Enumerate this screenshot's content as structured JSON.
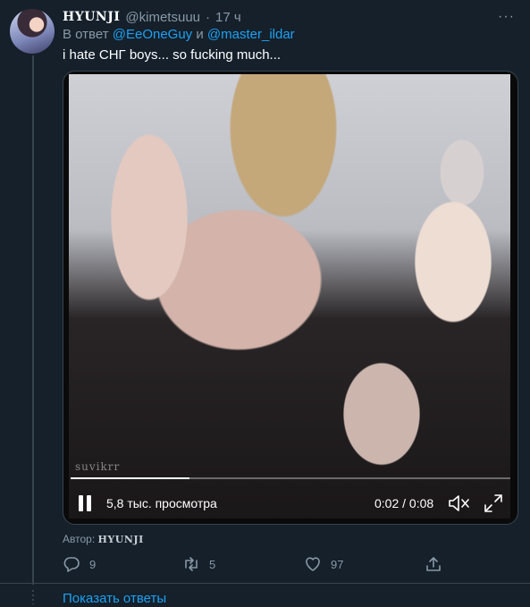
{
  "tweet": {
    "display_name": "HYUNJI",
    "handle": "@kimetsuuu",
    "separator": "·",
    "time": "17 ч",
    "more_glyph": "···",
    "reply_prefix": "В ответ",
    "reply_mention_1": "@EeOneGuy",
    "reply_conjunction": "и",
    "reply_mention_2": "@master_ildar",
    "text": "i hate СНГ boys... so fucking much..."
  },
  "video": {
    "watermark": "suvikrr",
    "progress_fraction": 0.27,
    "views": "5,8 тыс. просмотра",
    "timecode": "0:02 / 0:08"
  },
  "byline": {
    "prefix": "Автор:",
    "author": "HYUNJI"
  },
  "actions": {
    "replies": "9",
    "retweets": "5",
    "likes": "97"
  },
  "footer": {
    "show_replies": "Показать ответы"
  },
  "colors": {
    "background": "#15202b",
    "muted": "#8899a6",
    "accent": "#1da1f2",
    "border": "#38444d"
  }
}
